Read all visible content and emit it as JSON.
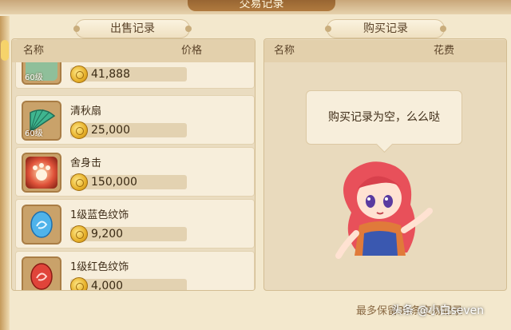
{
  "window": {
    "title": "交易记录"
  },
  "sell": {
    "tab_label": "出售记录",
    "col_name": "名称",
    "col_price": "价格",
    "items": [
      {
        "name": "",
        "level": "60级",
        "price": "41,888",
        "icon": "partial-item-icon"
      },
      {
        "name": "清秋扇",
        "level": "60级",
        "price": "25,000",
        "icon": "fan-icon"
      },
      {
        "name": "舍身击",
        "level": "",
        "price": "150,000",
        "icon": "skill-paw-icon"
      },
      {
        "name": "1级蓝色纹饰",
        "level": "",
        "price": "9,200",
        "icon": "blue-gem-icon"
      },
      {
        "name": "1级红色纹饰",
        "level": "",
        "price": "4,000",
        "icon": "red-gem-icon"
      }
    ]
  },
  "buy": {
    "tab_label": "购买记录",
    "col_name": "名称",
    "col_cost": "花费",
    "empty_message": "购买记录为空，么么哒"
  },
  "footer": {
    "note": "最多保留30条交易记录"
  },
  "watermark": {
    "text": "头条 @小白seven"
  },
  "colors": {
    "background": "#f3e8cd",
    "row": "#f7eedb",
    "coin": "#e7b12a",
    "text": "#3f2d18"
  }
}
